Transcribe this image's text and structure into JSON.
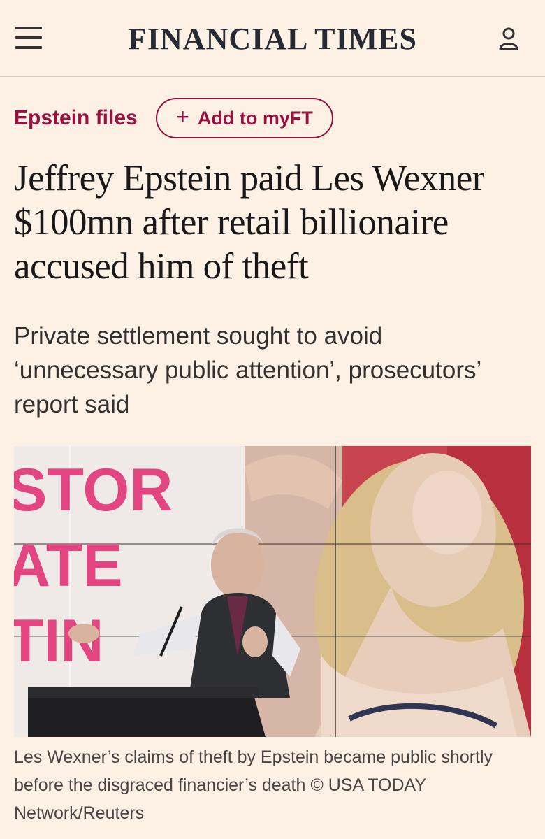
{
  "header": {
    "menu_icon": "hamburger-menu-icon",
    "masthead": "FINANCIAL TIMES",
    "user_icon": "user-account-icon"
  },
  "article": {
    "topic": "Epstein files",
    "myft_button": {
      "icon": "plus-icon",
      "label": "Add to myFT"
    },
    "headline": "Jeffrey Epstein paid Les Wexner $100mn after retail billionaire accused him of theft",
    "standfirst": "Private settlement sought to avoid ‘unnecessary public attention’, prosecutors’ report said",
    "image": {
      "background_text_lines": [
        "STOR",
        "ATE",
        "TIN"
      ],
      "caption": "Les Wexner’s claims of theft by Epstein became public shortly before the disgraced financier’s death © USA TODAY Network/Reuters"
    }
  },
  "colors": {
    "background": "#fdf1e6",
    "accent": "#990f3d",
    "text": "#33302e",
    "photo_pink_text": "#e2457f"
  }
}
